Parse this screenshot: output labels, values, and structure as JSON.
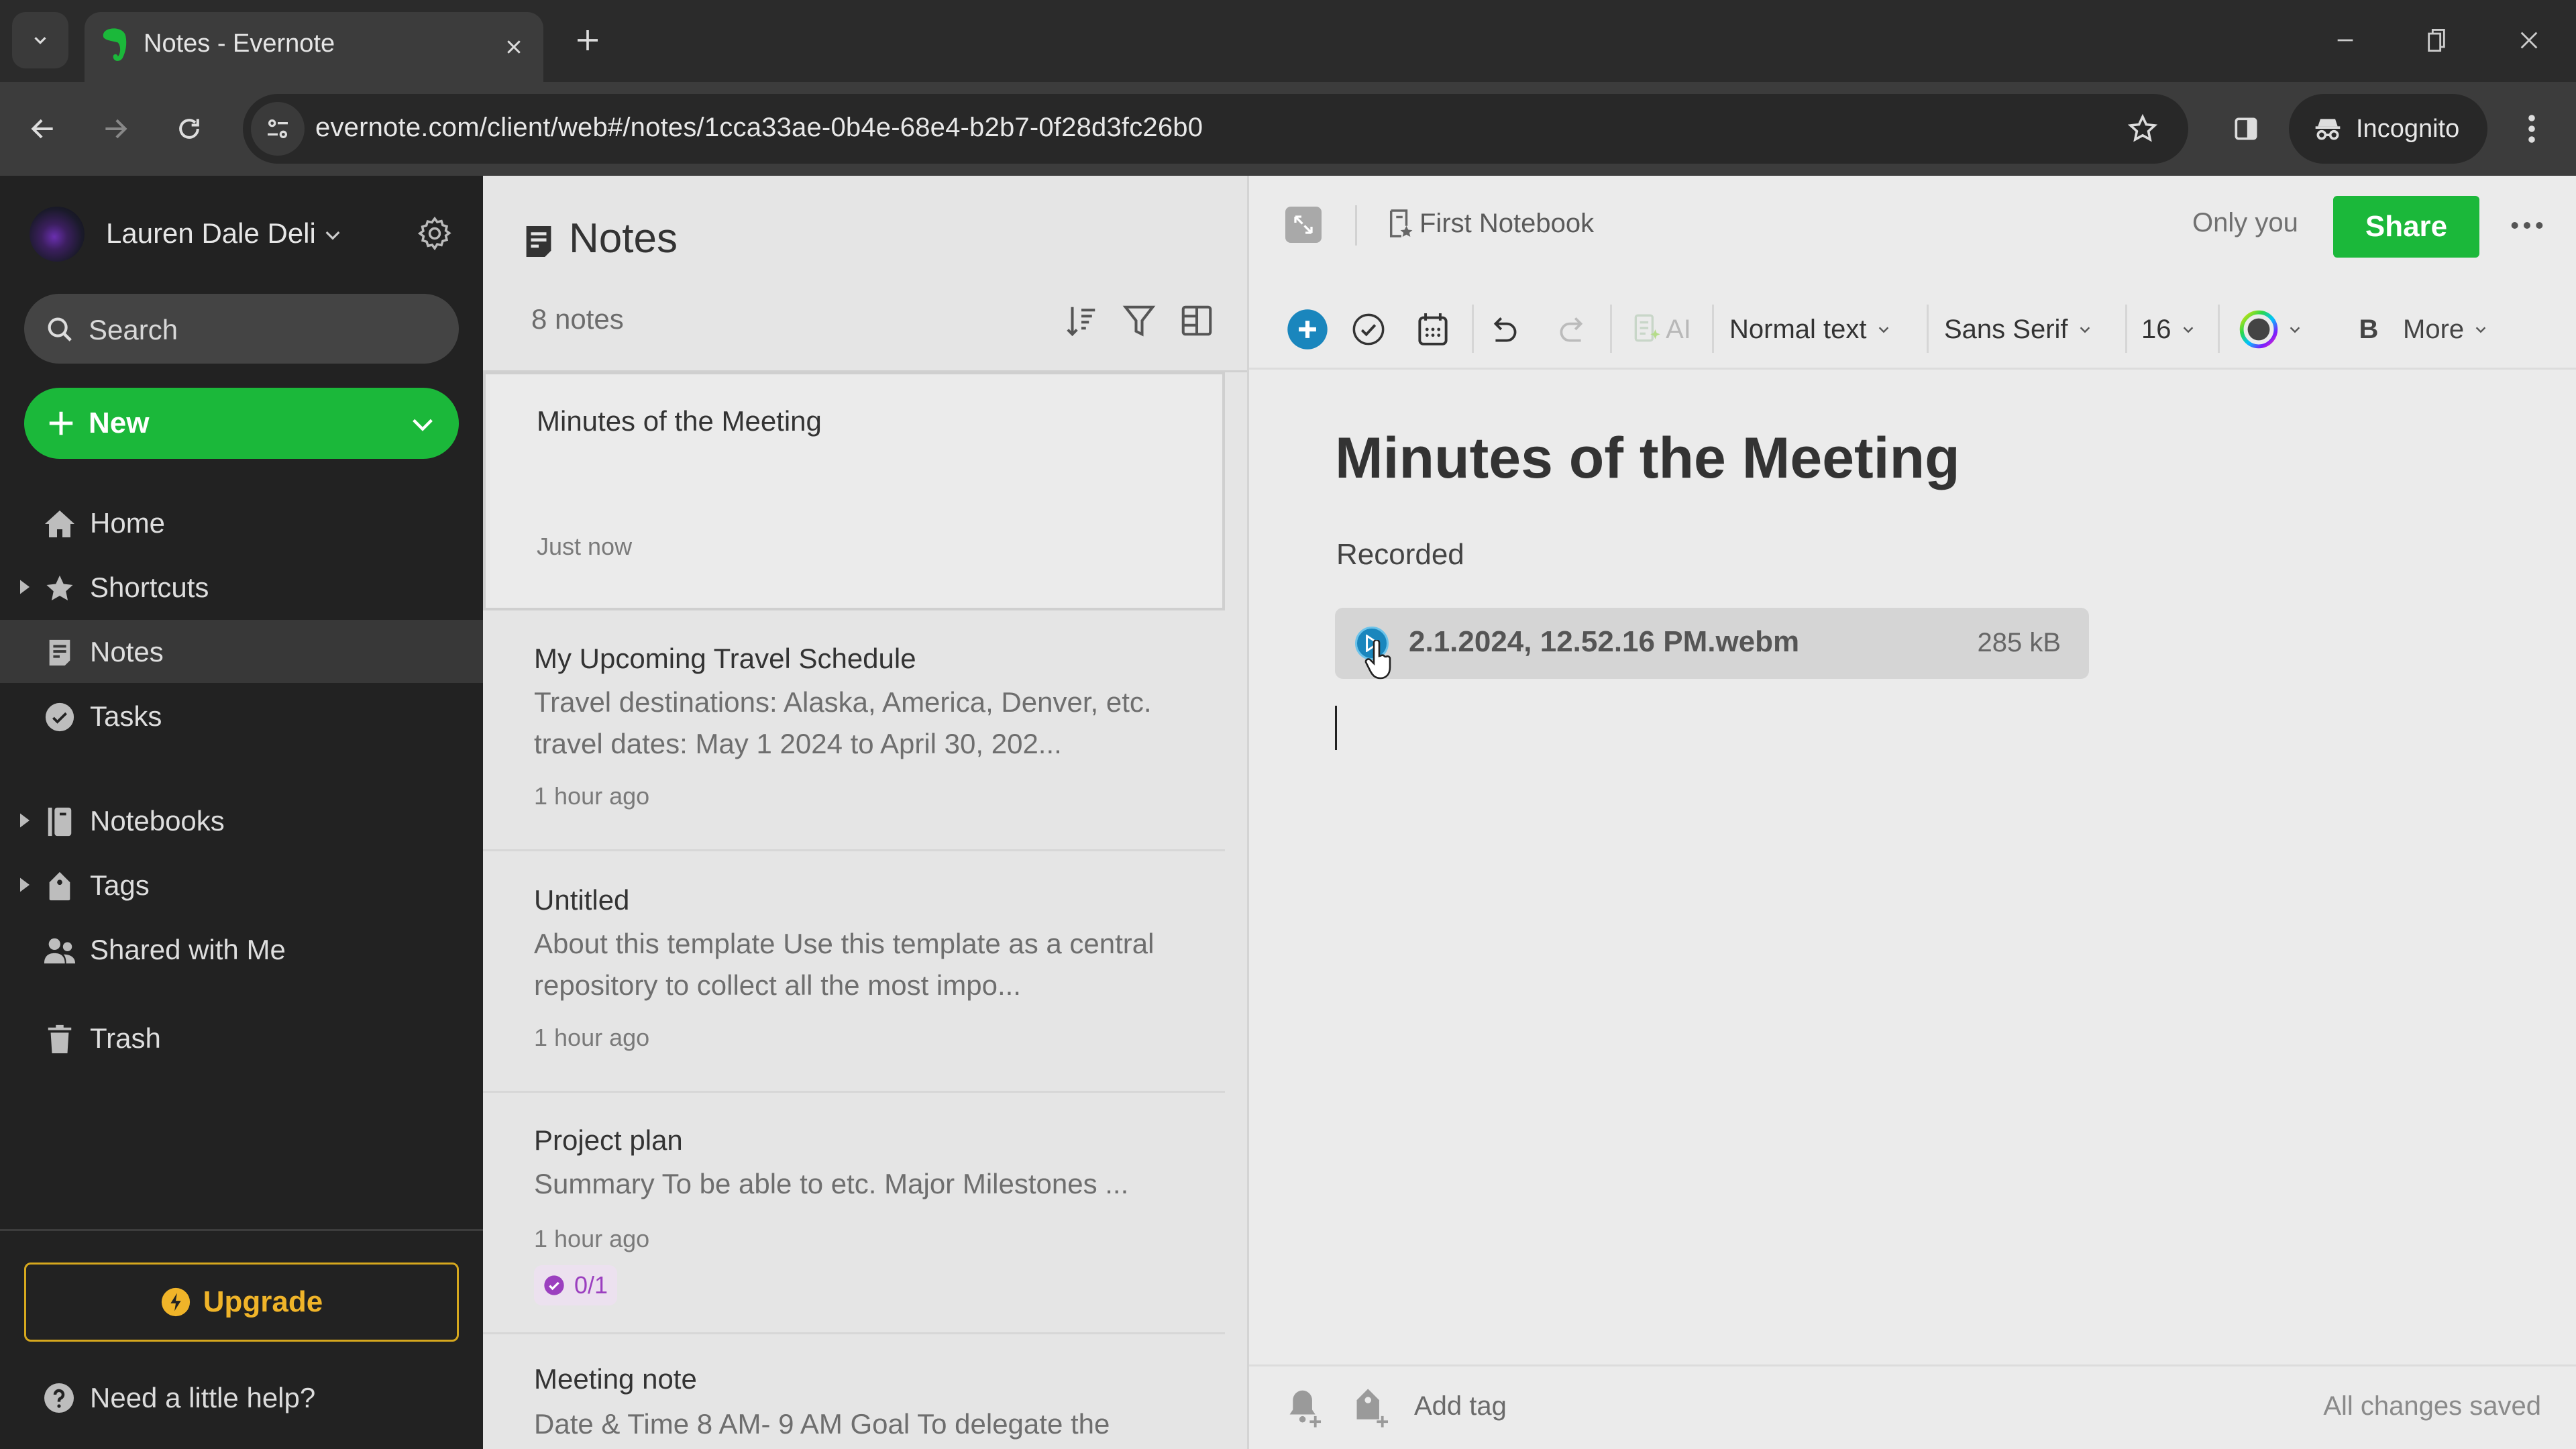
{
  "browser": {
    "tab_title": "Notes - Evernote",
    "url": "evernote.com/client/web#/notes/1cca33ae-0b4e-68e4-b2b7-0f28d3fc26b0",
    "profile_label": "Incognito"
  },
  "sidebar": {
    "user_name": "Lauren Dale Deli",
    "search_placeholder": "Search",
    "new_label": "New",
    "items": [
      {
        "label": "Home",
        "icon": "home-icon",
        "expandable": false,
        "active": false
      },
      {
        "label": "Shortcuts",
        "icon": "star-icon",
        "expandable": true,
        "active": false
      },
      {
        "label": "Notes",
        "icon": "note-icon",
        "expandable": false,
        "active": true
      },
      {
        "label": "Tasks",
        "icon": "check-circle-icon",
        "expandable": false,
        "active": false
      },
      {
        "label": "Notebooks",
        "icon": "notebook-icon",
        "expandable": true,
        "active": false
      },
      {
        "label": "Tags",
        "icon": "tag-icon",
        "expandable": true,
        "active": false
      },
      {
        "label": "Shared with Me",
        "icon": "people-icon",
        "expandable": false,
        "active": false
      },
      {
        "label": "Trash",
        "icon": "trash-icon",
        "expandable": false,
        "active": false
      }
    ],
    "upgrade_label": "Upgrade",
    "help_label": "Need a little help?"
  },
  "note_list": {
    "title": "Notes",
    "count": "8 notes",
    "notes": [
      {
        "title": "Minutes of the Meeting",
        "snippet": "",
        "time": "Just now",
        "selected": true
      },
      {
        "title": "My Upcoming Travel Schedule",
        "snippet": "Travel destinations: Alaska, America, Denver, etc. travel dates: May 1 2024 to April 30, 202...",
        "time": "1 hour ago"
      },
      {
        "title": "Untitled",
        "snippet": "About this template Use this template as a central repository to collect all the most impo...",
        "time": "1 hour ago"
      },
      {
        "title": "Project plan",
        "snippet": "Summary To be able to etc. Major Milestones ...",
        "time": "1 hour ago",
        "task_badge": "0/1"
      },
      {
        "title": "Meeting note",
        "snippet": "Date & Time 8 AM- 9 AM Goal To delegate the",
        "time": ""
      }
    ]
  },
  "editor": {
    "notebook": "First Notebook",
    "sharing_status": "Only you",
    "share_label": "Share",
    "toolbar": {
      "ai_label": "AI",
      "text_style": "Normal text",
      "font": "Sans Serif",
      "font_size": "16",
      "bold_label": "B",
      "more_label": "More"
    },
    "note_title": "Minutes of the Meeting",
    "body_text": "Recorded",
    "attachment": {
      "name": "2.1.2024, 12.52.16 PM.webm",
      "size": "285 kB"
    },
    "add_tag_label": "Add tag",
    "save_status": "All changes saved"
  },
  "colors": {
    "brand_green": "#1bb83a",
    "upgrade_gold": "#f0b429",
    "accent_blue": "#1a86bd",
    "task_purple": "#9b3fbf",
    "sidebar_bg": "#222222"
  }
}
